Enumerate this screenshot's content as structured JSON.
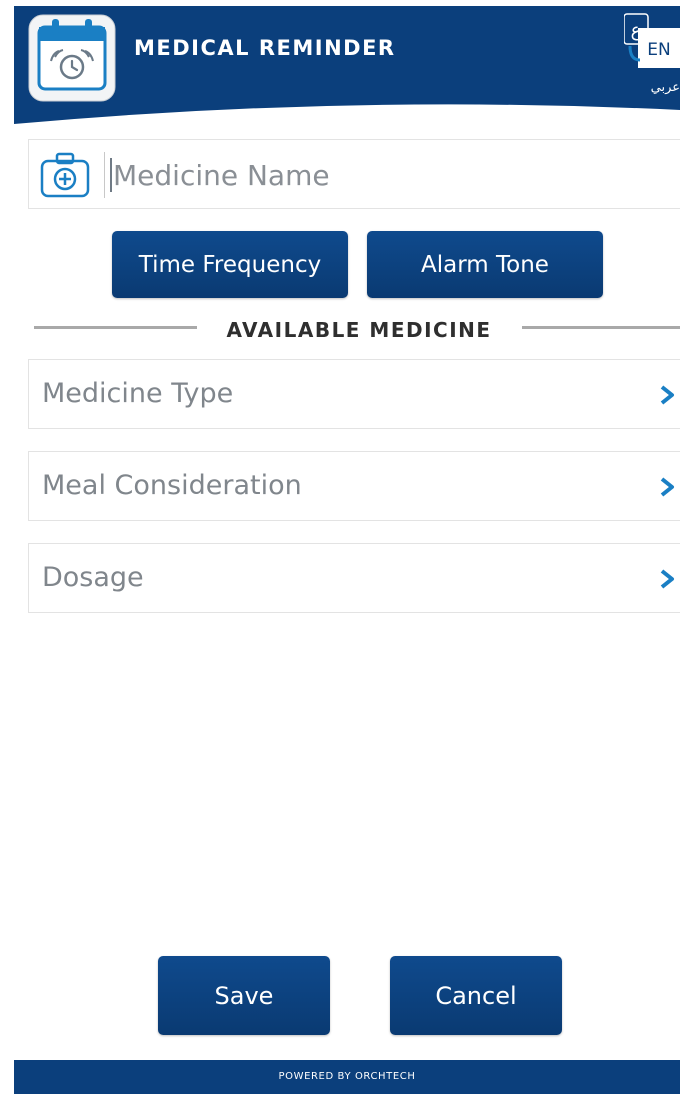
{
  "header": {
    "title": "MEDICAL REMINDER",
    "app_icon": "calendar-alarm-icon",
    "lang_icon": "language-switch-icon",
    "lang_badge": "EN",
    "lang_glyph": "ع",
    "lang_label": "عربي"
  },
  "form": {
    "medicine_name_placeholder": "Medicine Name",
    "medicine_name_value": "",
    "kit_icon": "medical-kit-icon"
  },
  "buttons": {
    "time_frequency": "Time Frequency",
    "alarm_tone": "Alarm Tone",
    "save": "Save",
    "cancel": "Cancel"
  },
  "section": {
    "title": "AVAILABLE MEDICINE"
  },
  "options": [
    {
      "label": "Medicine Type",
      "icon": "chevron-right-icon"
    },
    {
      "label": "Meal Consideration",
      "icon": "chevron-right-icon"
    },
    {
      "label": "Dosage",
      "icon": "chevron-right-icon"
    }
  ],
  "footer": {
    "text": "POWERED BY ORCHTECH"
  },
  "colors": {
    "primary": "#0b3f7c",
    "accent": "#1a7fc4",
    "border": "#e3e3e3",
    "muted_text": "#80868c"
  }
}
